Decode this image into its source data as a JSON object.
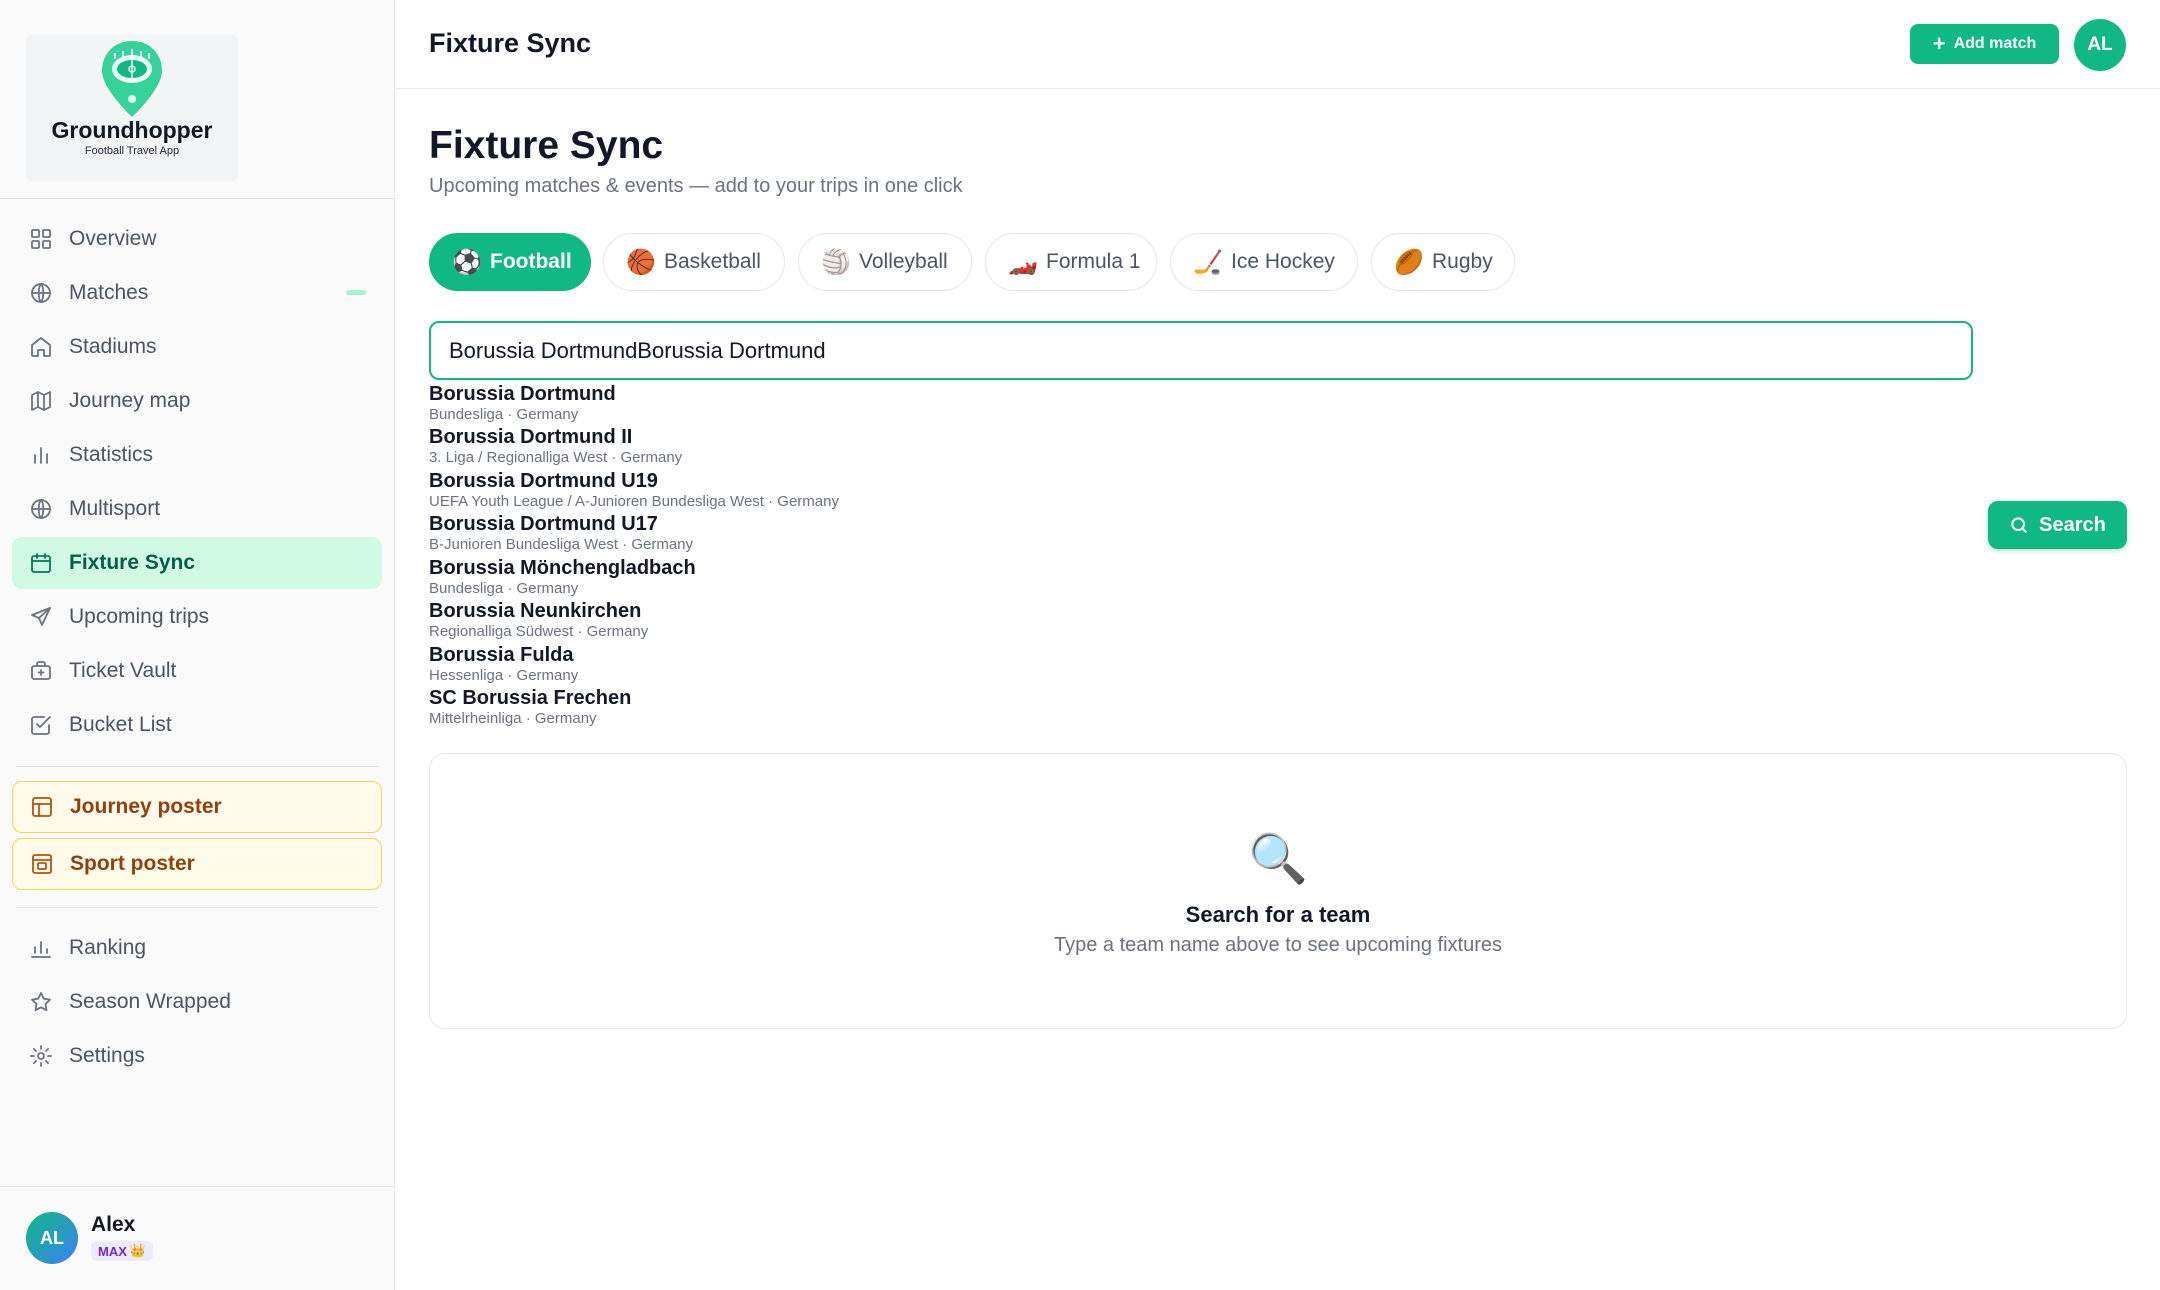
{
  "brand": {
    "name": "Groundhopper",
    "tagline": "Football Travel App"
  },
  "nav": [
    {
      "label": "Overview",
      "icon": "grid-icon"
    },
    {
      "label": "Matches",
      "icon": "globe-icon"
    },
    {
      "label": "Stadiums",
      "icon": "home-icon"
    },
    {
      "label": "Journey map",
      "icon": "map-icon"
    },
    {
      "label": "Statistics",
      "icon": "bar-chart-icon"
    },
    {
      "label": "Multisport",
      "icon": "globe-icon"
    },
    {
      "label": "Fixture Sync",
      "icon": "calendar-icon",
      "active": true
    },
    {
      "label": "Upcoming trips",
      "icon": "send-icon"
    },
    {
      "label": "Ticket Vault",
      "icon": "ticket-icon"
    },
    {
      "label": "Bucket List",
      "icon": "checkbox-icon"
    }
  ],
  "posters": [
    {
      "label": "Journey poster",
      "icon": "layout-icon"
    },
    {
      "label": "Sport poster",
      "icon": "image-icon"
    }
  ],
  "nav_bottom": [
    {
      "label": "Ranking",
      "icon": "bar-chart-icon"
    },
    {
      "label": "Season Wrapped",
      "icon": "star-icon"
    },
    {
      "label": "Settings",
      "icon": "gear-icon"
    }
  ],
  "user": {
    "initials": "AL",
    "name": "Alex",
    "plan": "MAX",
    "plan_icon": "👑"
  },
  "topbar": {
    "title": "Fixture Sync",
    "add_label": "Add match",
    "avatar_initials": "AL"
  },
  "page": {
    "title": "Fixture Sync",
    "subtitle": "Upcoming matches & events — add to your trips in one click"
  },
  "sports": [
    {
      "label": "Football",
      "emoji": "⚽",
      "active": true
    },
    {
      "label": "Basketball",
      "emoji": "🏀"
    },
    {
      "label": "Volleyball",
      "emoji": "🏐"
    },
    {
      "label": "Formula 1",
      "emoji": "🏎️"
    },
    {
      "label": "Ice Hockey",
      "emoji": "🏒"
    },
    {
      "label": "Rugby",
      "emoji": "🏉"
    }
  ],
  "search": {
    "value": "Borussia DortmundBorussia Dortmund",
    "button_label": "Search"
  },
  "suggestions": [
    {
      "name": "Borussia Dortmund",
      "meta": "Bundesliga · Germany"
    },
    {
      "name": "Borussia Dortmund II",
      "meta": "3. Liga / Regionalliga West · Germany"
    },
    {
      "name": "Borussia Dortmund U19",
      "meta": "UEFA Youth League / A-Junioren Bundesliga West · Germany"
    },
    {
      "name": "Borussia Dortmund U17",
      "meta": "B-Junioren Bundesliga West · Germany"
    },
    {
      "name": "Borussia Mönchengladbach",
      "meta": "Bundesliga · Germany"
    },
    {
      "name": "Borussia Neunkirchen",
      "meta": "Regionalliga Südwest · Germany"
    },
    {
      "name": "Borussia Fulda",
      "meta": "Hessenliga · Germany"
    },
    {
      "name": "SC Borussia Frechen",
      "meta": "Mittelrheinliga · Germany"
    }
  ],
  "empty": {
    "icon": "🔍",
    "title": "Search for a team",
    "subtitle": "Type a team name above to see upcoming fixtures"
  },
  "colors": {
    "accent": "#10b981",
    "active_bg": "#d1fae5",
    "poster_bg": "#fffbeb",
    "poster_border": "#fcd34d"
  }
}
